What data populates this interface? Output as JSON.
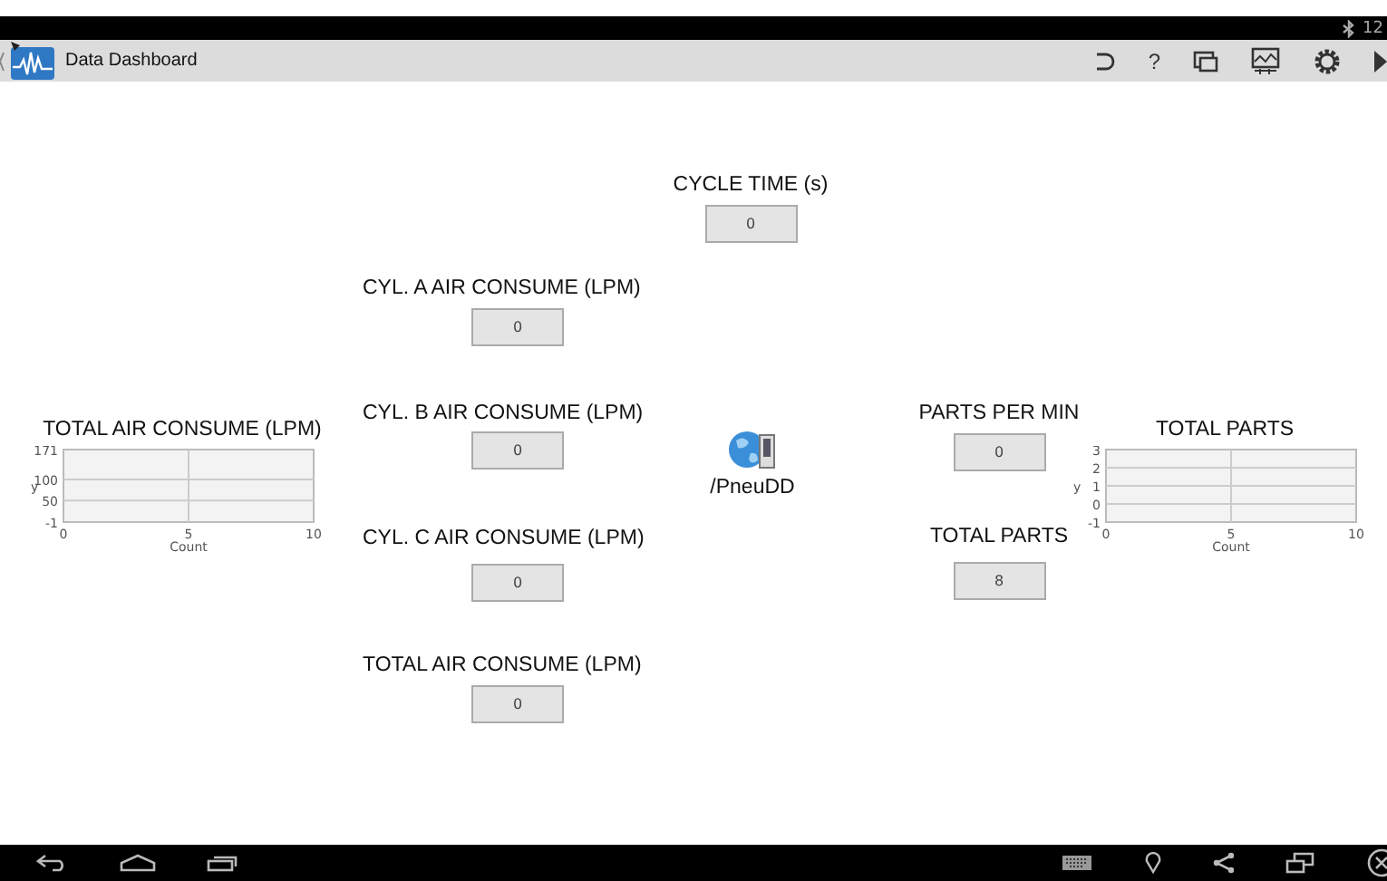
{
  "status_bar": {
    "clock": "12"
  },
  "action_bar": {
    "title": "Data Dashboard",
    "help": "?"
  },
  "widgets": [
    {
      "kind": "numeric",
      "label": "CYCLE TIME (s)",
      "value": "0"
    },
    {
      "kind": "numeric",
      "label": "CYL. A AIR CONSUME (LPM)",
      "value": "0"
    },
    {
      "kind": "chart",
      "chart_data": {
        "type": "line",
        "title": "TOTAL AIR CONSUME (LPM)",
        "xlabel": "Count",
        "ylabel": "y",
        "xlim": [
          0,
          10
        ],
        "ylim": [
          -1,
          171
        ],
        "xticks": [
          0,
          5,
          10
        ],
        "yticks": [
          -1,
          50,
          100,
          171
        ],
        "grid": true
      }
    },
    {
      "kind": "numeric",
      "label": "CYL. B AIR CONSUME (LPM)",
      "value": "0"
    },
    {
      "kind": "target",
      "label": "/PneuDD"
    },
    {
      "kind": "numeric",
      "label": "PARTS PER MIN",
      "value": "0"
    },
    {
      "kind": "chart",
      "chart_data": {
        "type": "line",
        "title": "TOTAL PARTS",
        "xlabel": "Count",
        "ylabel": "y",
        "xlim": [
          0,
          10
        ],
        "ylim": [
          -1,
          3
        ],
        "xticks": [
          0,
          5,
          10
        ],
        "yticks": [
          -1,
          0,
          1,
          2,
          3
        ],
        "grid": true
      }
    },
    {
      "kind": "numeric",
      "label": "CYL. C AIR CONSUME (LPM)",
      "value": "0"
    },
    {
      "kind": "numeric",
      "label": "TOTAL PARTS",
      "value": "8"
    },
    {
      "kind": "numeric",
      "label": "TOTAL AIR CONSUME (LPM)",
      "value": "0"
    }
  ]
}
